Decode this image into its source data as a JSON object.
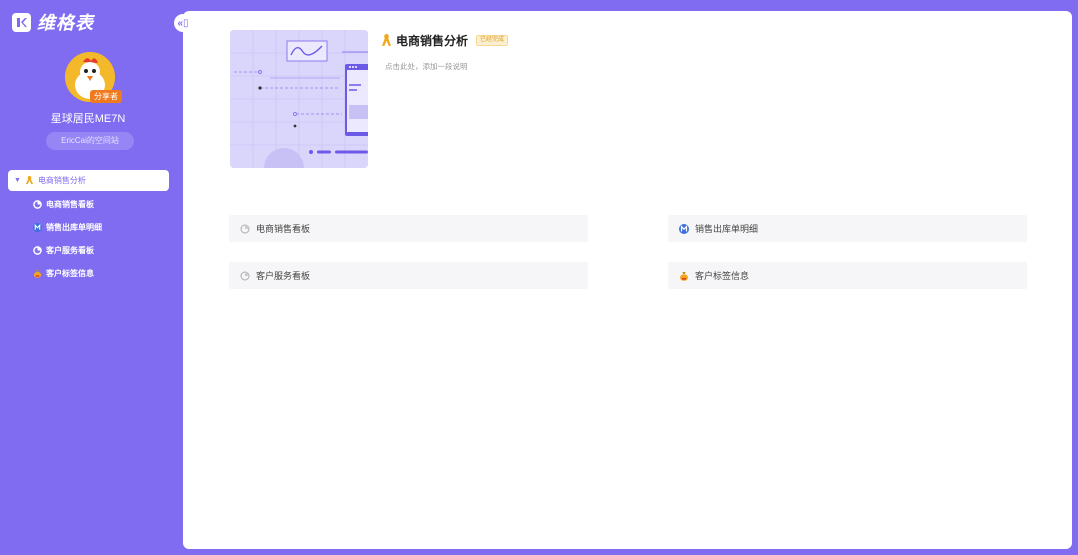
{
  "app": {
    "name": "维格表"
  },
  "sidebar": {
    "collapse_label": "«▯",
    "avatar_badge": "分享者",
    "username": "星球居民ME7N",
    "space_button": "EricCai的空间站",
    "active_folder": {
      "label": "电商销售分析",
      "icon": "ribbon-icon"
    },
    "items": [
      {
        "label": "电商销售看板",
        "icon": "dashboard-icon"
      },
      {
        "label": "销售出库单明细",
        "icon": "m-badge-icon"
      },
      {
        "label": "客户服务看板",
        "icon": "dashboard-icon"
      },
      {
        "label": "客户标签信息",
        "icon": "money-bag-icon"
      }
    ]
  },
  "main": {
    "title": "电商销售分析",
    "tag": "已经完成",
    "description": "点击此处，添加一段说明",
    "cards": [
      {
        "label": "电商销售看板",
        "icon": "dashboard-icon"
      },
      {
        "label": "销售出库单明细",
        "icon": "m-badge-icon"
      },
      {
        "label": "客户服务看板",
        "icon": "dashboard-icon"
      },
      {
        "label": "客户标签信息",
        "icon": "money-bag-icon"
      }
    ]
  },
  "colors": {
    "brand": "#7f6cf1",
    "ribbon": "#f2a81d",
    "m_badge": "#3a6fdc"
  }
}
